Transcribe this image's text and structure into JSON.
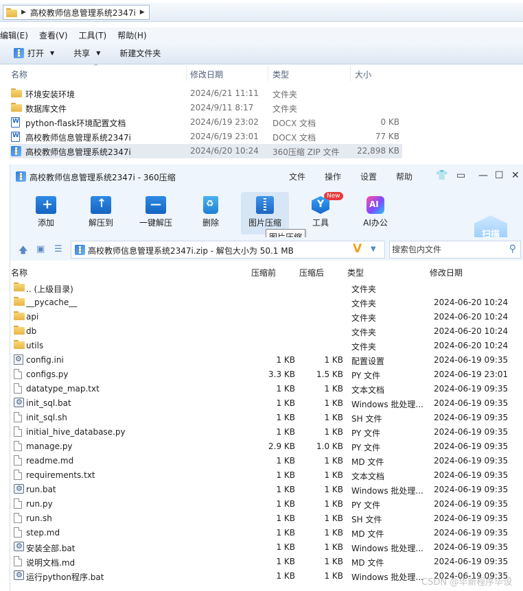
{
  "explorer": {
    "breadcrumb": "高校教师信息管理系统2347i",
    "menu": [
      "编辑(E)",
      "查看(V)",
      "工具(T)",
      "帮助(H)"
    ],
    "toolbar": {
      "open": "打开",
      "share": "共享",
      "new_folder": "新建文件夹"
    },
    "columns": {
      "name": "名称",
      "modified": "修改日期",
      "type": "类型",
      "size": "大小"
    },
    "rows": [
      {
        "name": "环境安装环境",
        "date": "2024/6/21 11:11",
        "type": "文件夹",
        "size": "",
        "icon": "folder-icon"
      },
      {
        "name": "数据库文件",
        "date": "2024/9/11 8:17",
        "type": "文件夹",
        "size": "",
        "icon": "folder-icon"
      },
      {
        "name": "python-flask环境配置文档",
        "date": "2024/6/19 23:02",
        "type": "DOCX 文档",
        "size": "0 KB",
        "icon": "doc-icon"
      },
      {
        "name": "高校教师信息管理系统2347i",
        "date": "2024/6/19 23:01",
        "type": "DOCX 文档",
        "size": "77 KB",
        "icon": "doc-icon"
      },
      {
        "name": "高校教师信息管理系统2347i",
        "date": "2024/6/20 10:24",
        "type": "360压缩 ZIP 文件",
        "size": "22,898 KB",
        "icon": "zip-icon",
        "selected": true
      }
    ]
  },
  "zip": {
    "title": "高校教师信息管理系统2347i - 360压缩",
    "menu": [
      "文件",
      "操作",
      "设置",
      "帮助"
    ],
    "tools": [
      {
        "label": "添加",
        "icon": "add-icon"
      },
      {
        "label": "解压到",
        "icon": "extract-icon"
      },
      {
        "label": "一键解压",
        "icon": "one-click-extract-icon"
      },
      {
        "label": "删除",
        "icon": "delete-icon"
      },
      {
        "label": "图片压缩",
        "icon": "image-compress-icon"
      },
      {
        "label": "工具",
        "icon": "tools-icon"
      },
      {
        "label": "AI办公",
        "icon": "ai-office-icon"
      }
    ],
    "new_badge": "New",
    "tooltip": "图片压缩",
    "scan_label": "扫描",
    "path_text": "高校教师信息管理系统2347i.zip - 解包大小为 50.1 MB",
    "path_v": "V",
    "search_placeholder": "搜索包内文件",
    "columns": {
      "name": "名称",
      "before": "压缩前",
      "after": "压缩后",
      "type": "类型",
      "modified": "修改日期"
    },
    "rows": [
      {
        "name": ".. (上级目录)",
        "before": "",
        "after": "",
        "type": "文件夹",
        "date": "",
        "icon": "folder-icon"
      },
      {
        "name": "__pycache__",
        "before": "",
        "after": "",
        "type": "文件夹",
        "date": "2024-06-20 10:24",
        "icon": "folder-icon"
      },
      {
        "name": "api",
        "before": "",
        "after": "",
        "type": "文件夹",
        "date": "2024-06-20 10:24",
        "icon": "folder-icon"
      },
      {
        "name": "db",
        "before": "",
        "after": "",
        "type": "文件夹",
        "date": "2024-06-20 10:24",
        "icon": "folder-icon"
      },
      {
        "name": "utils",
        "before": "",
        "after": "",
        "type": "文件夹",
        "date": "2024-06-20 10:24",
        "icon": "folder-icon"
      },
      {
        "name": "config.ini",
        "before": "1 KB",
        "after": "1 KB",
        "type": "配置设置",
        "date": "2024-06-19 09:35",
        "icon": "settings-file-icon"
      },
      {
        "name": "configs.py",
        "before": "3.3 KB",
        "after": "1.5 KB",
        "type": "PY 文件",
        "date": "2024-06-19 23:01",
        "icon": "file-icon"
      },
      {
        "name": "datatype_map.txt",
        "before": "1 KB",
        "after": "1 KB",
        "type": "文本文档",
        "date": "2024-06-19 09:35",
        "icon": "file-icon"
      },
      {
        "name": "init_sql.bat",
        "before": "1 KB",
        "after": "1 KB",
        "type": "Windows 批处理...",
        "date": "2024-06-19 09:35",
        "icon": "batch-file-icon"
      },
      {
        "name": "init_sql.sh",
        "before": "1 KB",
        "after": "1 KB",
        "type": "SH 文件",
        "date": "2024-06-19 09:35",
        "icon": "file-icon"
      },
      {
        "name": "initial_hive_database.py",
        "before": "1 KB",
        "after": "1 KB",
        "type": "PY 文件",
        "date": "2024-06-19 09:35",
        "icon": "file-icon"
      },
      {
        "name": "manage.py",
        "before": "2.9 KB",
        "after": "1.0 KB",
        "type": "PY 文件",
        "date": "2024-06-19 09:35",
        "icon": "file-icon"
      },
      {
        "name": "readme.md",
        "before": "1 KB",
        "after": "1 KB",
        "type": "MD 文件",
        "date": "2024-06-19 09:35",
        "icon": "file-icon"
      },
      {
        "name": "requirements.txt",
        "before": "1 KB",
        "after": "1 KB",
        "type": "文本文档",
        "date": "2024-06-19 09:35",
        "icon": "file-icon"
      },
      {
        "name": "run.bat",
        "before": "1 KB",
        "after": "1 KB",
        "type": "Windows 批处理...",
        "date": "2024-06-19 09:35",
        "icon": "batch-file-icon"
      },
      {
        "name": "run.py",
        "before": "1 KB",
        "after": "1 KB",
        "type": "PY 文件",
        "date": "2024-06-19 09:35",
        "icon": "file-icon"
      },
      {
        "name": "run.sh",
        "before": "1 KB",
        "after": "1 KB",
        "type": "SH 文件",
        "date": "2024-06-19 09:35",
        "icon": "file-icon"
      },
      {
        "name": "step.md",
        "before": "1 KB",
        "after": "1 KB",
        "type": "MD 文件",
        "date": "2024-06-19 09:35",
        "icon": "file-icon"
      },
      {
        "name": "安装全部.bat",
        "before": "1 KB",
        "after": "1 KB",
        "type": "Windows 批处理...",
        "date": "2024-06-19 09:35",
        "icon": "batch-file-icon"
      },
      {
        "name": "说明文档.md",
        "before": "1 KB",
        "after": "1 KB",
        "type": "MD 文件",
        "date": "2024-06-19 09:35",
        "icon": "file-icon"
      },
      {
        "name": "运行python程序.bat",
        "before": "1 KB",
        "after": "1 KB",
        "type": "Windows 批处理...",
        "date": "2024-06-19 09:35",
        "icon": "batch-file-icon"
      }
    ]
  },
  "watermark": "CSDN @毕新程序毕设"
}
